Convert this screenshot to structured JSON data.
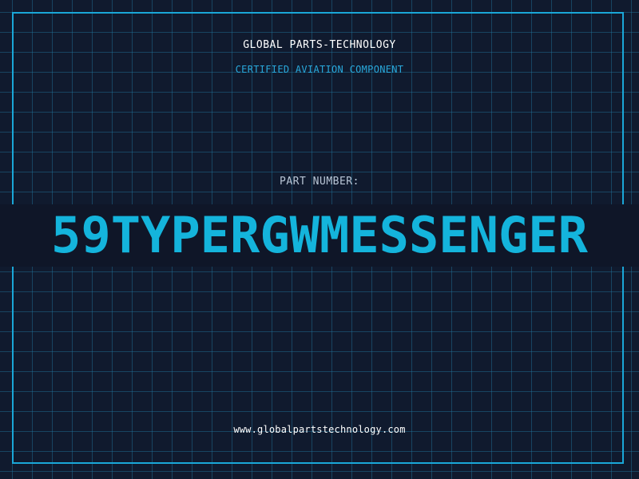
{
  "header": {
    "company": "GLOBAL PARTS-TECHNOLOGY",
    "subtitle": "CERTIFIED AVIATION COMPONENT"
  },
  "part": {
    "label": "PART NUMBER:",
    "number": "59TYPERGWMESSENGER"
  },
  "footer": {
    "url": "www.globalpartstechnology.com"
  },
  "colors": {
    "background": "#101a2e",
    "grid": "#1e5a7a",
    "accent": "#14b4dc",
    "frame": "#1aa7d8"
  }
}
